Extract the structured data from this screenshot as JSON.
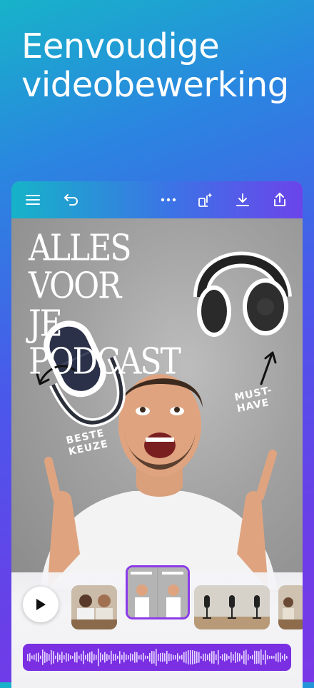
{
  "headline": {
    "line1": "Eenvoudige",
    "line2": "videobewerking"
  },
  "toolbar": {
    "icons": [
      "menu-icon",
      "undo-icon",
      "more-icon",
      "magic-resize-icon",
      "download-icon",
      "share-icon"
    ]
  },
  "poster": {
    "title_line1": "ALLES VOOR",
    "title_line2": "JE PODCAST",
    "note_mic_line1": "BESTE",
    "note_mic_line2": "KEUZE",
    "note_hp_line1": "MUST-",
    "note_hp_line2": "HAVE"
  },
  "timeline": {
    "clips": [
      "two-hosts-clip",
      "poster-clip-selected",
      "microphones-clip",
      "studio-clip"
    ]
  },
  "colors": {
    "accent": "#7a2fe3",
    "toolbar_start": "#16b3c8",
    "toolbar_end": "#6b44ea"
  }
}
